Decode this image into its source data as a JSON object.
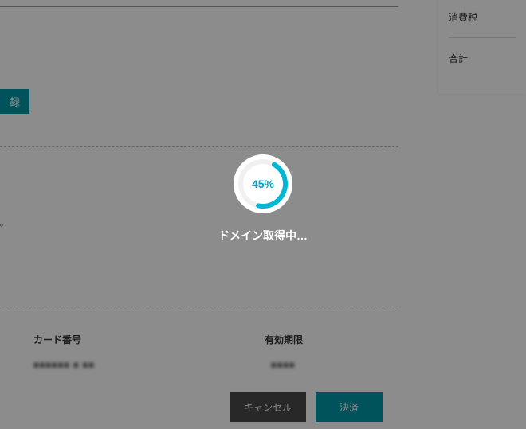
{
  "topbar": {
    "register_label": "録"
  },
  "subtext": "。",
  "payment": {
    "card_number_label": "カード番号",
    "card_number_value": "■■■■■■ ■ ■■",
    "expiry_label": "有効期限",
    "expiry_value": "■■■■"
  },
  "buttons": {
    "cancel_label": "キャンセル",
    "submit_label": "決済"
  },
  "side": {
    "tax_label": "消費税",
    "total_label": "合計"
  },
  "loading": {
    "percent_value": 45,
    "percent_label": "45%",
    "message": "ドメイン取得中…"
  },
  "colors": {
    "accent": "#0097a7",
    "spinner": "#00b7d4"
  }
}
